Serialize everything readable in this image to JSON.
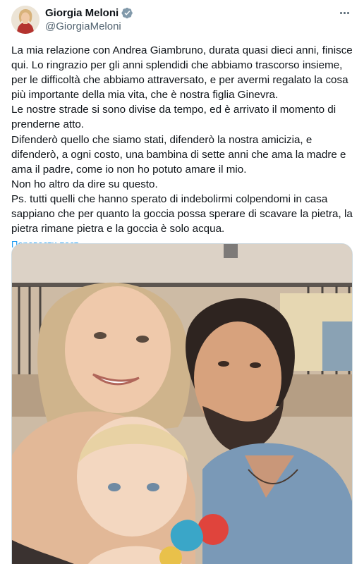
{
  "author": {
    "display_name": "Giorgia Meloni",
    "handle": "@GiorgiaMeloni",
    "verified": true,
    "verified_color": "#829aab",
    "avatar_icon": "avatar-photo"
  },
  "post": {
    "lines": [
      "La mia relazione con Andrea Giambruno, durata quasi dieci anni, finisce qui. Lo ringrazio per gli anni splendidi che abbiamo trascorso insieme, per le difficoltà che abbiamo attraversato, e per avermi regalato la cosa più importante della mia vita, che è nostra figlia Ginevra.",
      "Le nostre strade si sono divise da tempo, ed è arrivato il momento di prenderne atto.",
      "Difenderò quello che siamo stati, difenderò la nostra amicizia, e difenderò, a ogni costo, una bambina di sette anni che ama la madre e ama il padre, come io non ho potuto amare il mio.",
      "Non ho altro da dire su questo.",
      "Ps. tutti quelli che hanno sperato di indebolirmi colpendomi in casa sappiano che per quanto la goccia possa sperare di scavare la pietra, la pietra rimane pietra e la goccia è solo acqua."
    ],
    "translate_label": "Перевести пост"
  },
  "media": {
    "type": "photo",
    "subject": "family-photo"
  },
  "colors": {
    "link": "#1d9bf0",
    "secondary_text": "#536471",
    "primary_text": "#0f1419"
  }
}
